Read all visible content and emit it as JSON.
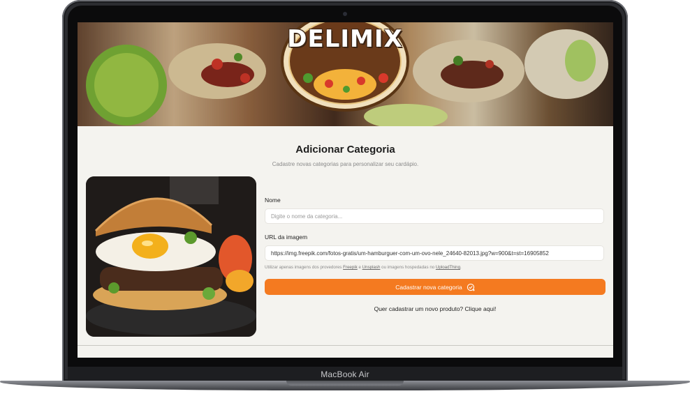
{
  "device": {
    "label": "MacBook Air"
  },
  "hero": {
    "logo_text": "DELIMIX"
  },
  "page": {
    "title": "Adicionar Categoria",
    "subtitle": "Cadastre novas categorias para personalizar seu cardápio."
  },
  "form": {
    "name_label": "Nome",
    "name_placeholder": "Digite o nome da categoria...",
    "name_value": "",
    "url_label": "URL da imagem",
    "url_value": "https://img.freepik.com/fotos-gratis/um-hamburguer-com-um-ovo-nele_24640-82013.jpg?w=900&t=st=16905852",
    "hint": {
      "prefix": "Utilizar apenas imagens dos provedores ",
      "provider_1": "Freepik",
      "sep": " e ",
      "provider_2": "Unsplash",
      "middle": " ou imagens hospedadas no ",
      "provider_3": "UploadThing",
      "suffix": "."
    },
    "submit_label": "Cadastrar nova categoria",
    "product_link": "Quer cadastrar um novo produto? Clique aqui!"
  },
  "colors": {
    "accent": "#f47a20",
    "background": "#f4f3ef",
    "frame": "#2b2c30"
  },
  "icons": {
    "submit": "check-badge-icon"
  }
}
